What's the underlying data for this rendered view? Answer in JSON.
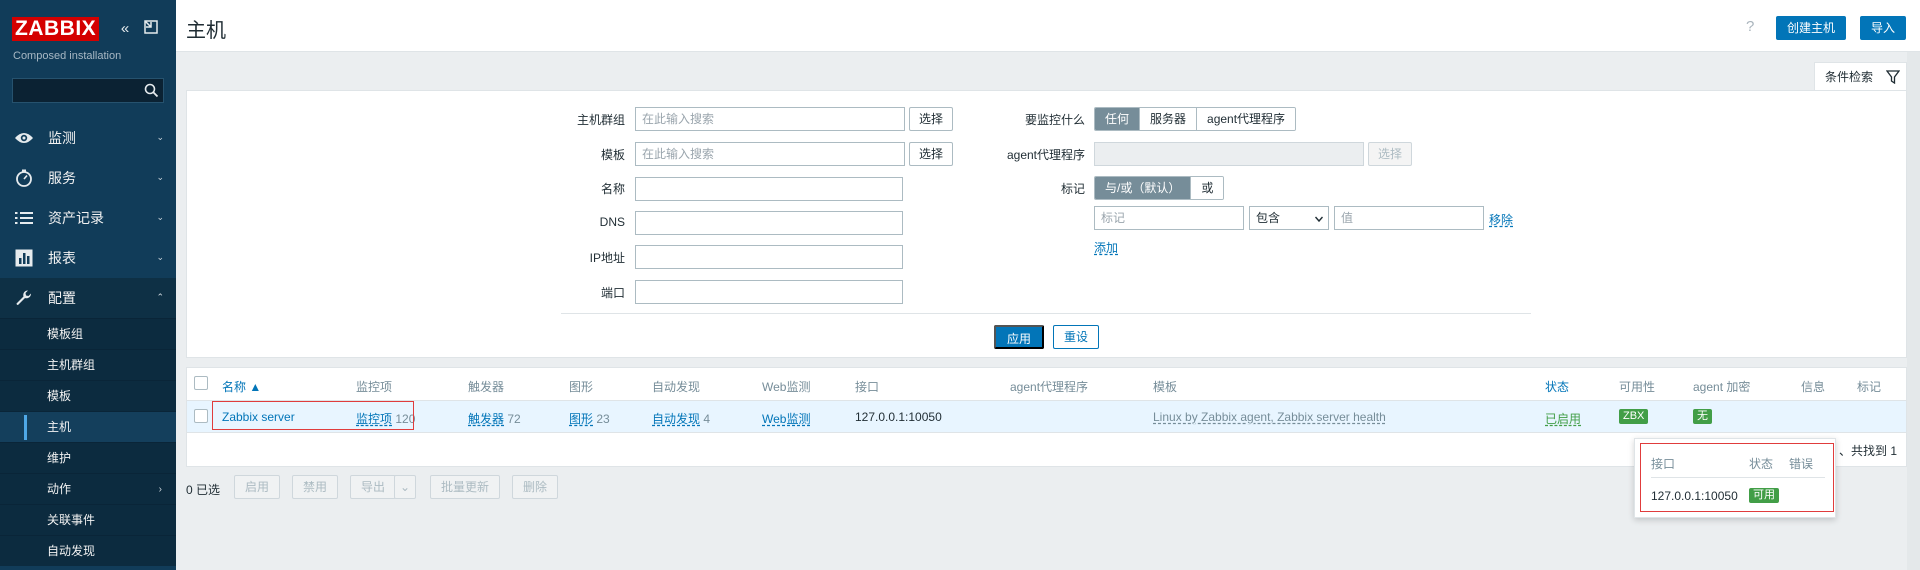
{
  "sidebar": {
    "logo": "ZABBIX",
    "subtitle": "Composed installation",
    "menu": [
      {
        "label": "监测",
        "icon": "eye-icon"
      },
      {
        "label": "服务",
        "icon": "clock-icon"
      },
      {
        "label": "资产记录",
        "icon": "list-icon"
      },
      {
        "label": "报表",
        "icon": "report-icon"
      },
      {
        "label": "配置",
        "icon": "wrench-icon"
      }
    ],
    "submenu": [
      "模板组",
      "主机群组",
      "模板",
      "主机",
      "维护",
      "动作",
      "关联事件",
      "自动发现"
    ]
  },
  "header": {
    "title": "主机",
    "help": "?",
    "create_host": "创建主机",
    "import": "导入"
  },
  "filter": {
    "tab_label": "条件检索",
    "host_groups_label": "主机群组",
    "host_groups_placeholder": "在此输入搜索",
    "templates_label": "模板",
    "templates_placeholder": "在此输入搜索",
    "select_btn": "选择",
    "name_label": "名称",
    "dns_label": "DNS",
    "ip_label": "IP地址",
    "port_label": "端口",
    "monitored_by_label": "要监控什么",
    "monitored_by_options": [
      "任何",
      "服务器",
      "agent代理程序"
    ],
    "proxy_label": "agent代理程序",
    "tags_label": "标记",
    "tags_options": [
      "与/或（默认）",
      "或"
    ],
    "tag_placeholder": "标记",
    "operator_value": "包含",
    "value_placeholder": "值",
    "remove": "移除",
    "add": "添加",
    "apply": "应用",
    "reset": "重设"
  },
  "table": {
    "columns": [
      "名称 ▲",
      "监控项",
      "触发器",
      "图形",
      "自动发现",
      "Web监测",
      "接口",
      "agent代理程序",
      "模板",
      "状态",
      "可用性",
      "agent 加密",
      "信息",
      "标记"
    ],
    "row": {
      "name": "Zabbix server",
      "items_label": "监控项",
      "items_count": "120",
      "triggers_label": "触发器",
      "triggers_count": "72",
      "graphs_label": "图形",
      "graphs_count": "23",
      "discovery_label": "自动发现",
      "discovery_count": "4",
      "web_label": "Web监测",
      "interface": "127.0.0.1:10050",
      "templates": "Linux by Zabbix agent, Zabbix server health",
      "status": "已启用",
      "availability": "ZBX",
      "encryption": "无"
    },
    "found": "、共找到 1"
  },
  "footer": {
    "selected": "0 已选",
    "buttons": [
      "启用",
      "禁用",
      "导出",
      "批量更新",
      "删除"
    ]
  },
  "popup": {
    "col_interface": "接口",
    "col_status": "状态",
    "col_error": "错误",
    "interface": "127.0.0.1:10050",
    "status": "可用"
  },
  "colors": {
    "sidebar_bg": "#113c59",
    "primary": "#0275b8",
    "green": "#429e47",
    "logo_red": "#d40000"
  }
}
